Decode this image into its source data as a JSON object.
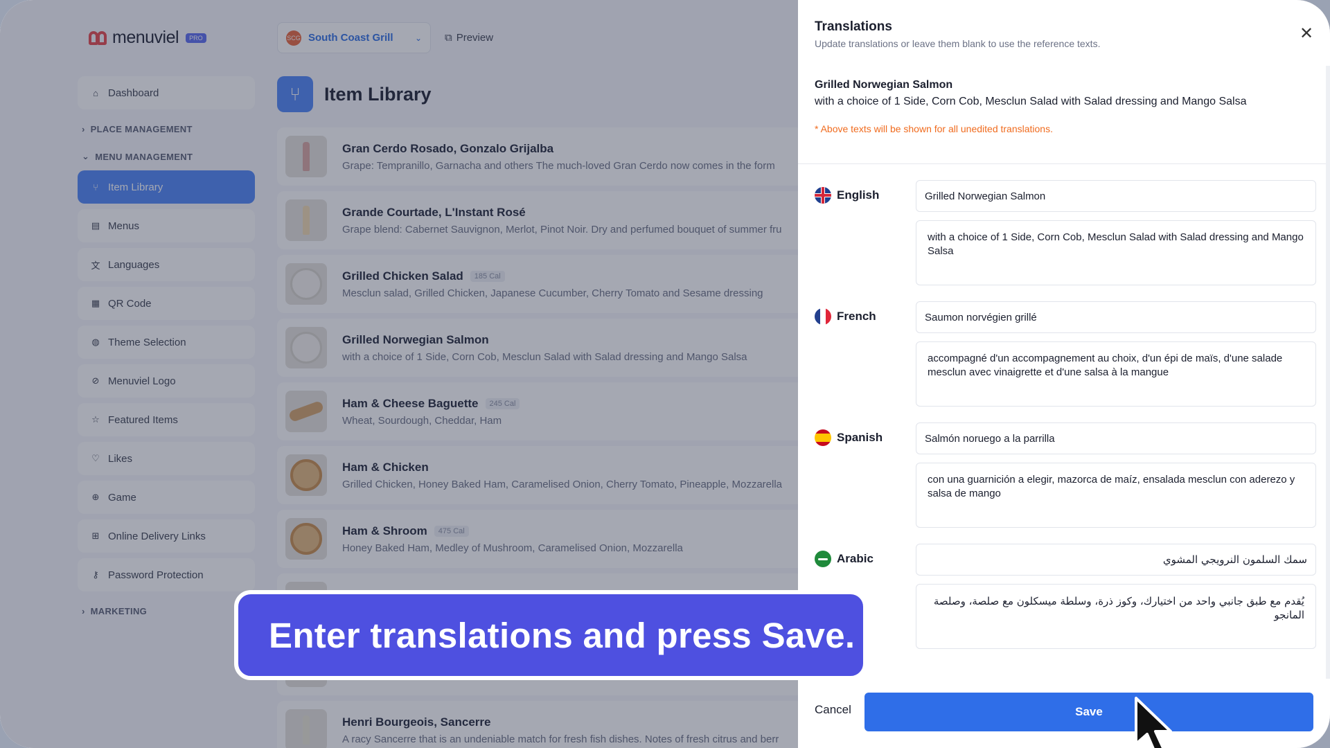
{
  "app": {
    "brand": "menuviel",
    "brand_badge": "PRO",
    "place": "South Coast Grill",
    "place_avatar": "SCG",
    "preview": "Preview"
  },
  "sidebar": {
    "dashboard": "Dashboard",
    "place_management": "PLACE MANAGEMENT",
    "menu_management": "MENU MANAGEMENT",
    "items": [
      "Item Library",
      "Menus",
      "Languages",
      "QR Code",
      "Theme Selection",
      "Menuviel Logo",
      "Featured Items",
      "Likes",
      "Game",
      "Online Delivery Links",
      "Password Protection"
    ],
    "marketing": "MARKETING"
  },
  "library": {
    "title": "Item Library",
    "items": [
      {
        "name": "Gran Cerdo Rosado, Gonzalo Grijalba",
        "cal": "",
        "desc": "Grape: Tempranillo, Garnacha and others The much-loved Gran Cerdo now comes in the form"
      },
      {
        "name": "Grande Courtade, L'Instant Rosé",
        "cal": "",
        "desc": "Grape blend: Cabernet Sauvignon, Merlot, Pinot Noir. Dry and perfumed bouquet of summer fru"
      },
      {
        "name": "Grilled Chicken Salad",
        "cal": "185 Cal",
        "desc": "Mesclun salad, Grilled Chicken, Japanese Cucumber, Cherry Tomato and Sesame dressing"
      },
      {
        "name": "Grilled Norwegian Salmon",
        "cal": "",
        "desc": "with a choice of 1 Side, Corn Cob, Mesclun Salad with Salad dressing and Mango Salsa"
      },
      {
        "name": "Ham & Cheese Baguette",
        "cal": "245 Cal",
        "desc": "Wheat, Sourdough, Cheddar, Ham"
      },
      {
        "name": "Ham & Chicken",
        "cal": "",
        "desc": "Grilled Chicken, Honey Baked Ham, Caramelised Onion, Cherry Tomato, Pineapple, Mozzarella"
      },
      {
        "name": "Ham & Shroom",
        "cal": "475 Cal",
        "desc": "Honey Baked Ham, Medley of Mushroom, Caramelised Onion, Mozzarella"
      },
      {
        "name": "",
        "cal": "",
        "desc": ""
      },
      {
        "name": "",
        "cal": "",
        "desc": ""
      },
      {
        "name": "Henri Bourgeois, Sancerre",
        "cal": "",
        "desc": "A racy Sancerre that is an undeniable match for fresh fish dishes. Notes of fresh citrus and berr"
      }
    ]
  },
  "drawer": {
    "title": "Translations",
    "subtitle": "Update translations or leave them blank to use the reference texts.",
    "ref_name": "Grilled Norwegian Salmon",
    "ref_desc": "with a choice of 1 Side, Corn Cob, Mesclun Salad with Salad dressing and Mango Salsa",
    "note": "* Above texts will be shown for all unedited translations.",
    "languages": [
      {
        "label": "English",
        "name": "Grilled Norwegian Salmon",
        "desc": "with a choice of 1 Side, Corn Cob, Mesclun Salad with Salad dressing and Mango Salsa"
      },
      {
        "label": "French",
        "name": "Saumon norvégien grillé",
        "desc": "accompagné d'un accompagnement au choix, d'un épi de maïs, d'une salade mesclun avec vinaigrette et d'une salsa à la mangue"
      },
      {
        "label": "Spanish",
        "name": "Salmón noruego a la parrilla",
        "desc": "con una guarnición a elegir, mazorca de maíz, ensalada mesclun con aderezo y salsa de mango"
      },
      {
        "label": "Arabic",
        "name": "سمك السلمون النرويجي المشوي",
        "desc": "يُقدم مع طبق جانبي واحد من اختيارك، وكوز ذرة، وسلطة ميسكلون مع صلصة، وصلصة المانجو"
      }
    ],
    "cancel": "Cancel",
    "save": "Save"
  },
  "banner": {
    "text": "Enter translations and press Save."
  },
  "icons": {
    "close": "close-icon",
    "cursor": "cursor-pointer-icon"
  },
  "colors": {
    "accent": "#2f6ee8",
    "banner": "#4e50e0",
    "note": "#f06b1e"
  }
}
